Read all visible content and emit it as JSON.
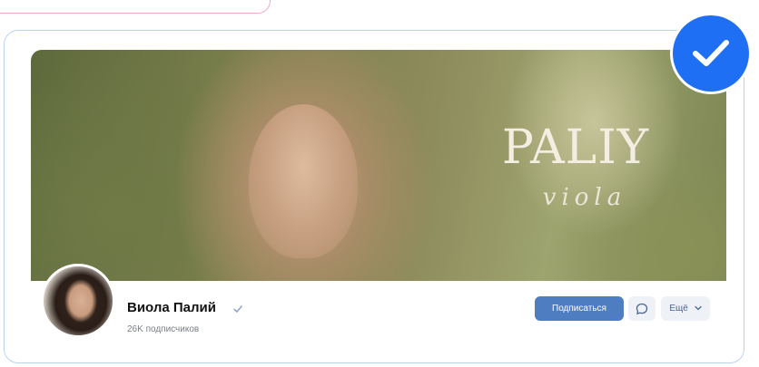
{
  "profile": {
    "name": "Виола Палий",
    "subscribers": "26K подписчиков"
  },
  "cover": {
    "logo_text": "PALIY",
    "logo_script": "viola"
  },
  "actions": {
    "subscribe_label": "Подписаться",
    "more_label": "Ещё"
  },
  "icons": {
    "verified": "check-mark-icon",
    "message": "message-bubble-icon",
    "more": "chevron-down-icon",
    "badge": "checkmark-badge-icon"
  },
  "colors": {
    "accent": "#4f7dc2",
    "badge": "#1f6ff5",
    "card_border": "#b9d3ef",
    "pink_border": "#f3a8c4"
  }
}
